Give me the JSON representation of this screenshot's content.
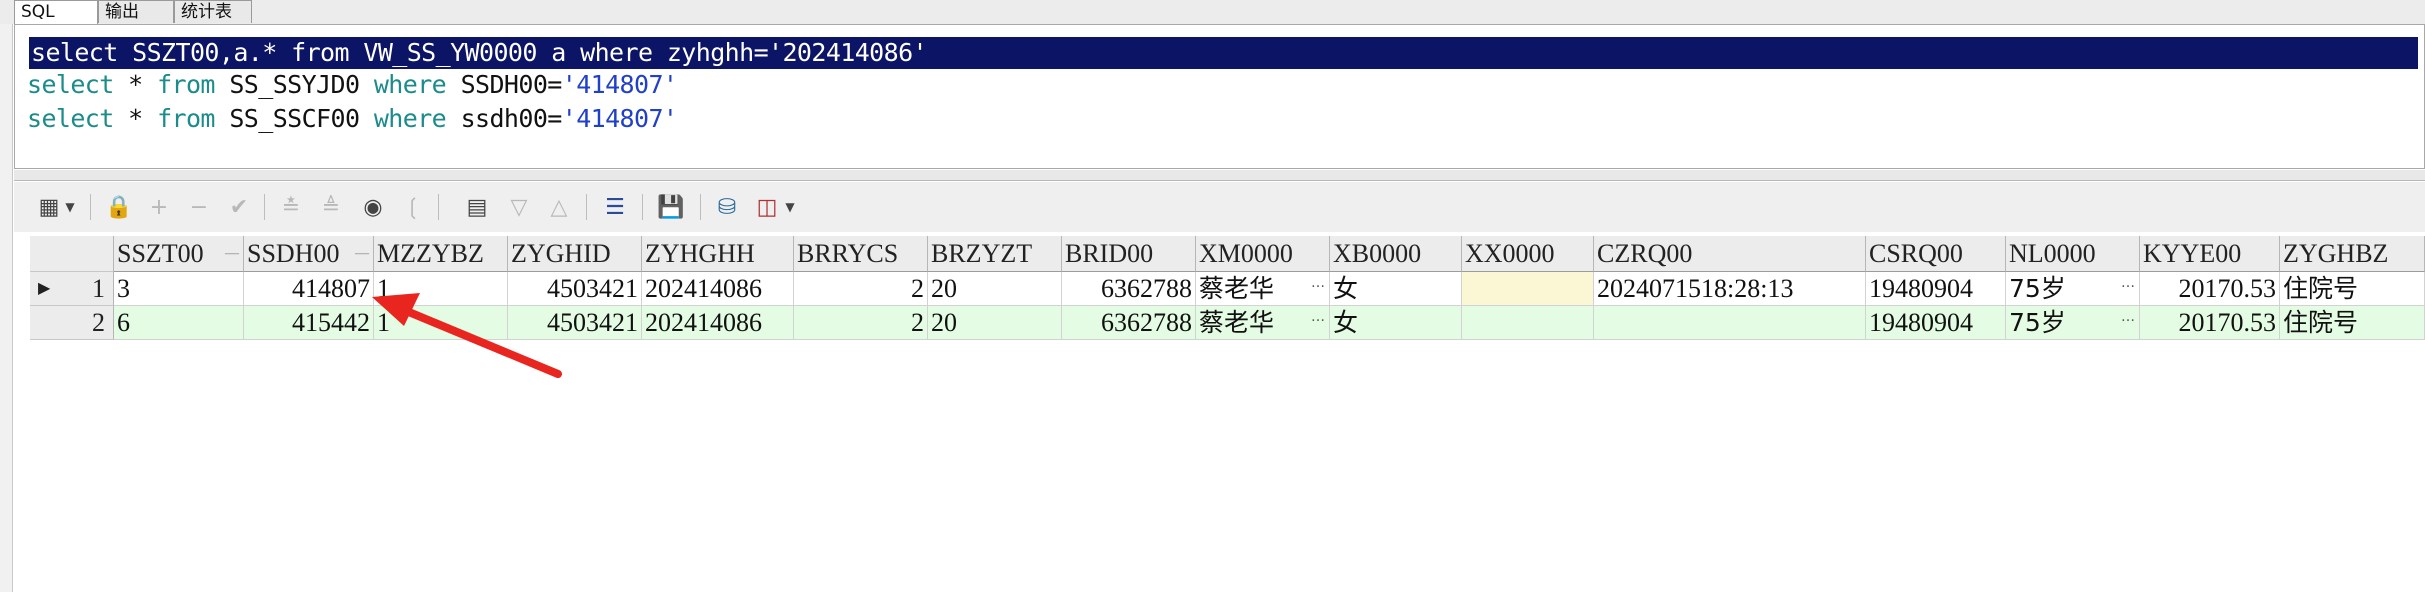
{
  "tabs": [
    {
      "label": "SQL",
      "active": true
    },
    {
      "label": "输出",
      "active": false
    },
    {
      "label": "统计表",
      "active": false
    }
  ],
  "editor": {
    "lines": [
      {
        "text": "select SSZT00,a.* from VW_SS_YW0000 a where zyhghh='202414086'"
      },
      {
        "kw1": "select",
        "p1": " * ",
        "kw2": "from",
        "p2": " SS_SSYJD0 ",
        "kw3": "where",
        "p3": " SSDH00=",
        "str": "'414807'"
      },
      {
        "kw1": "select",
        "p1": " * ",
        "kw2": "from",
        "p2": " SS_SSCF00 ",
        "kw3": "where",
        "p3": " ssdh00=",
        "str": "'414807'"
      }
    ]
  },
  "toolbar": {
    "icons": [
      "grid-view-icon",
      "dropdown-icon",
      "lock-icon",
      "add-record-icon",
      "delete-record-icon",
      "post-icon",
      "filter-icon",
      "clear-filter-icon",
      "find-icon",
      "erase-icon",
      "query-icon",
      "sort-desc-icon",
      "sort-asc-icon",
      "tree-icon",
      "save-icon",
      "export-db-icon",
      "chart-icon",
      "chart-dropdown-icon"
    ]
  },
  "grid": {
    "columns": [
      "SSZT00",
      "SSDH00",
      "MZZYBZ",
      "ZYGHID",
      "ZYHGHH",
      "BRRYCS",
      "BRZYZT",
      "BRID00",
      "XM0000",
      "XB0000",
      "XX0000",
      "CZRQ00",
      "CSRQ00",
      "NL0000",
      "KYYE00",
      "ZYGHBZ"
    ],
    "rows": [
      {
        "num": "1",
        "cells": [
          "3",
          "414807",
          "1",
          "4503421",
          "202414086",
          "2",
          "20",
          "6362788",
          "蔡老华",
          "女",
          "",
          "2024071518:28:13",
          "19480904",
          "75岁",
          "20170.53",
          "住院号"
        ]
      },
      {
        "num": "2",
        "cells": [
          "6",
          "415442",
          "1",
          "4503421",
          "202414086",
          "2",
          "20",
          "6362788",
          "蔡老华",
          "女",
          "",
          "",
          "19480904",
          "75岁",
          "20170.53",
          "住院号"
        ]
      }
    ]
  },
  "annotation": {
    "color": "#e8261f"
  }
}
